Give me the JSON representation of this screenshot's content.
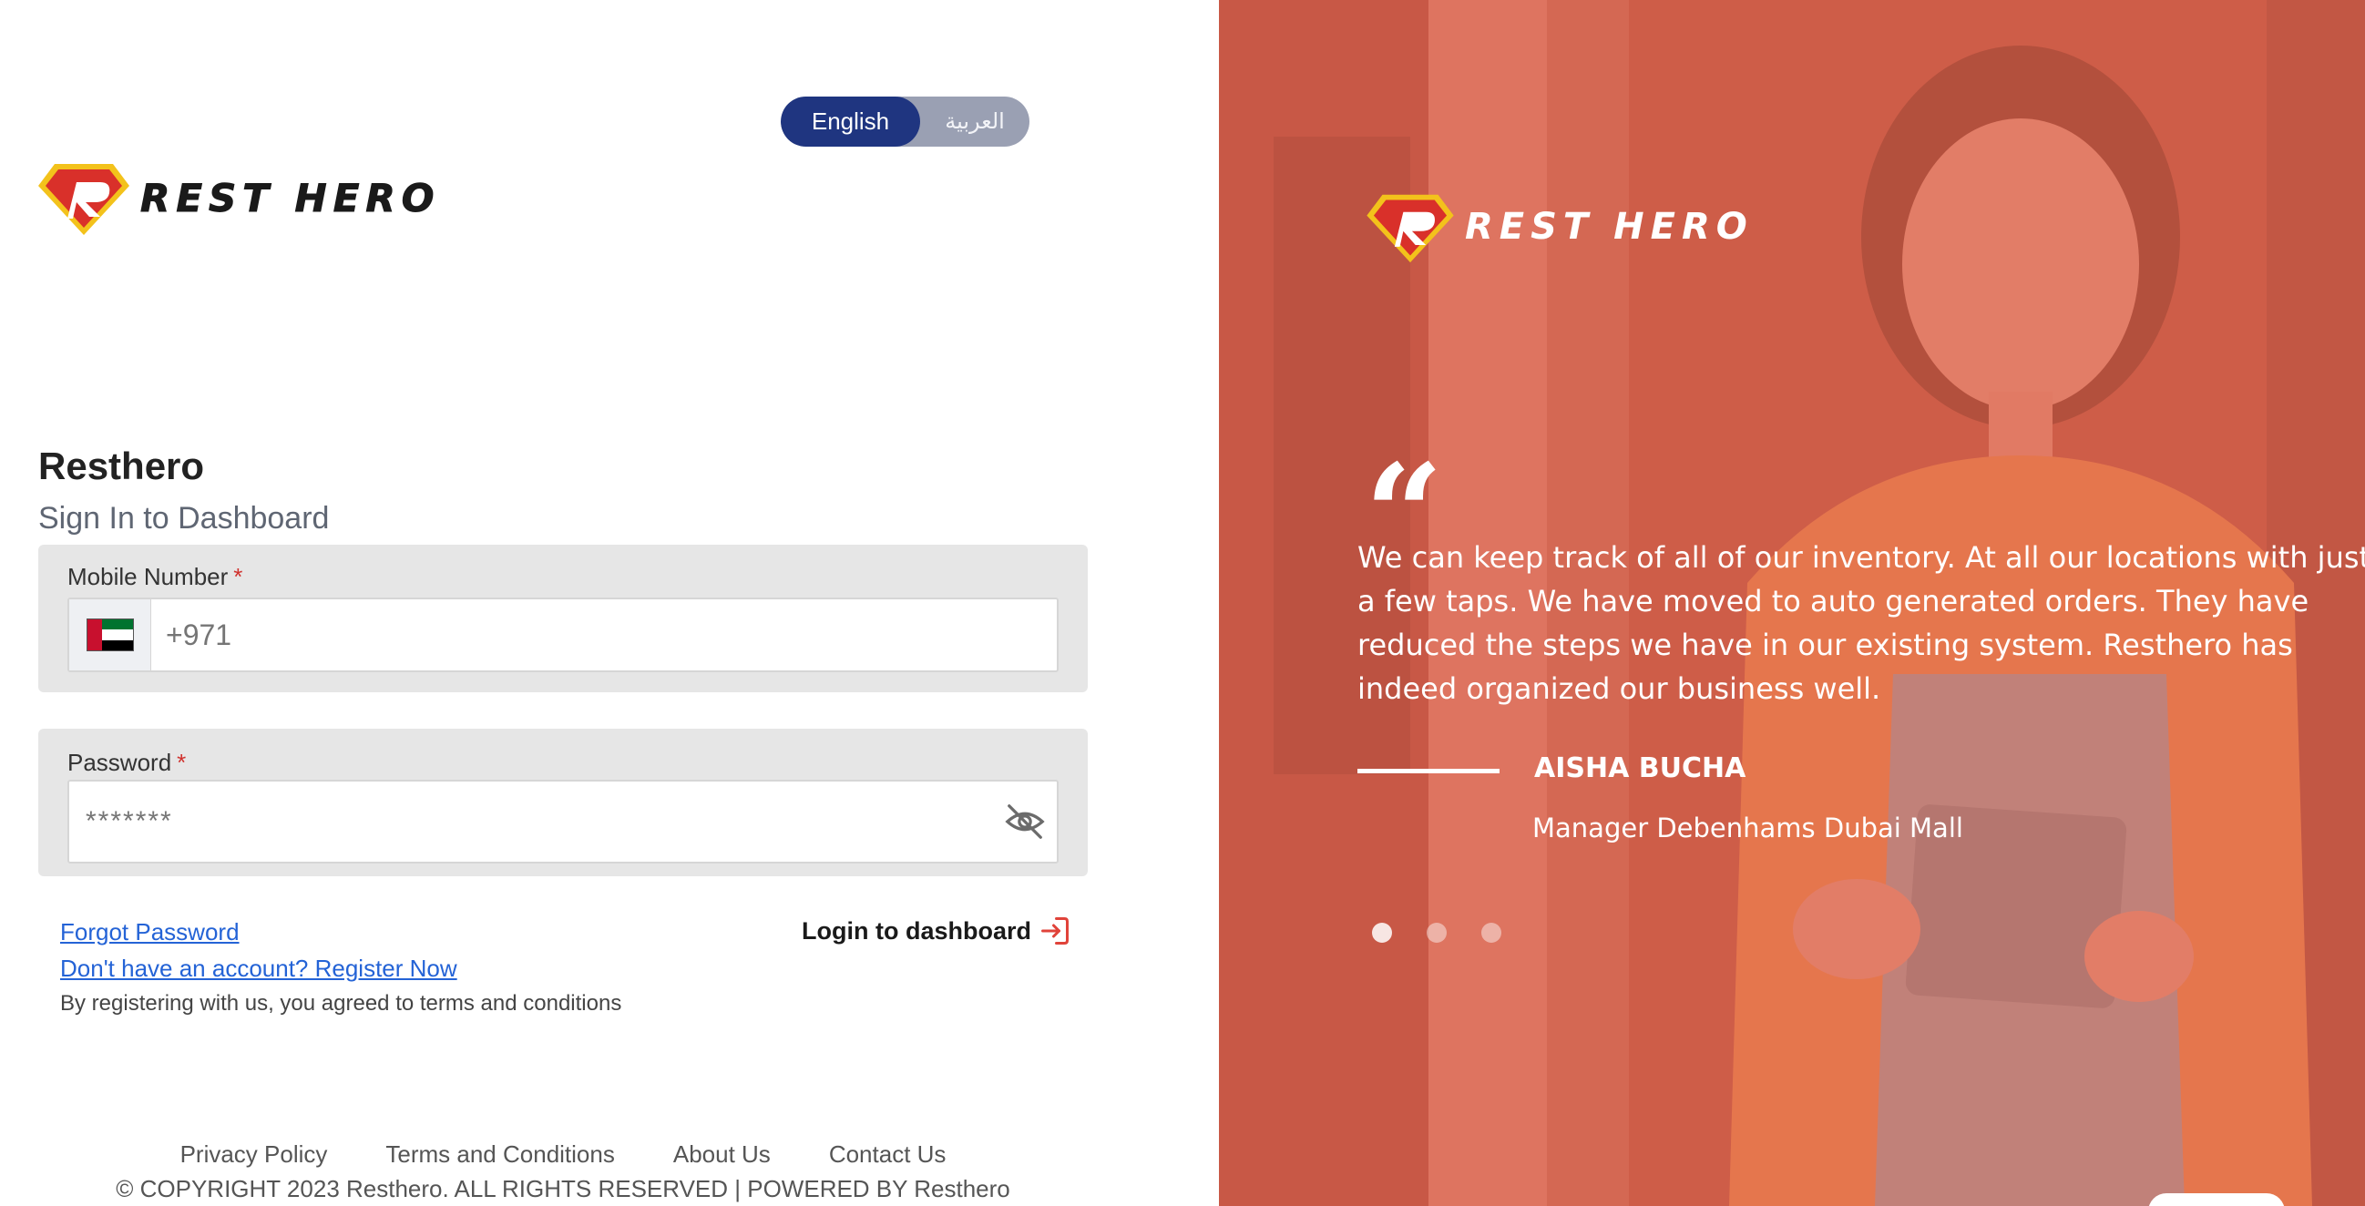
{
  "language": {
    "options": [
      "English",
      "العربية"
    ],
    "active": "English"
  },
  "brand": {
    "logo_text": "REST HERO",
    "name": "Resthero",
    "subtitle": "Sign In to Dashboard"
  },
  "form": {
    "mobile": {
      "label": "Mobile Number",
      "required_mark": "*",
      "country_flag": "uae-flag-icon",
      "placeholder": "+971",
      "value": ""
    },
    "password": {
      "label": "Password",
      "required_mark": "*",
      "placeholder": "*******",
      "value": "",
      "visibility_icon": "eye-off-icon"
    },
    "forgot_password": "Forgot Password",
    "register_link": "Don't have an account? Register Now",
    "agreement_note": "By registering with us, you agreed to terms and conditions",
    "login_button": "Login to dashboard",
    "login_icon": "login-arrow-icon"
  },
  "footer": {
    "links": [
      "Privacy Policy",
      "Terms and Conditions",
      "About Us",
      "Contact Us"
    ],
    "copyright": "© COPYRIGHT 2023 Resthero. ALL RIGHTS RESERVED | POWERED BY Resthero"
  },
  "testimonial": {
    "logo_text": "REST HERO",
    "quote_icon": "quote-icon",
    "quote_mark": "“",
    "text": "We can keep track of all of our inventory. At all our locations with just a few taps. We have moved to auto generated orders. They have reduced the steps we have in our existing system. Resthero has indeed organized our business well.",
    "author": "AISHA BUCHA",
    "role": "Manager Debenhams Dubai Mall",
    "slides": 3,
    "active_slide": 1
  },
  "colors": {
    "accent_navy": "#1f3580",
    "overlay_coral": "#e26650",
    "link_blue": "#2463d6",
    "required_red": "#d0312d",
    "card_gray": "#e6e6e6"
  }
}
